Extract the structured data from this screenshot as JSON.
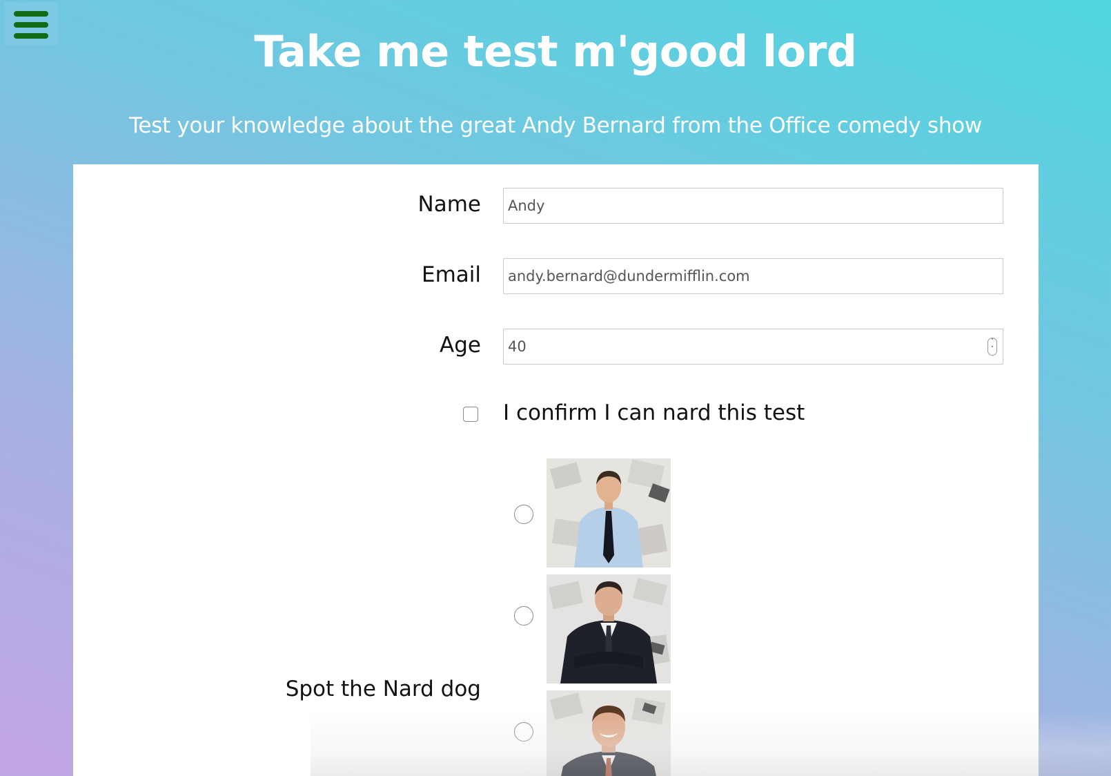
{
  "header": {
    "menu_icon": "hamburger-menu-icon",
    "menu_color": "#116a16",
    "title": "Take me test m'good lord",
    "subtitle": "Test your knowledge about the great Andy Bernard from the Office comedy show"
  },
  "form": {
    "name": {
      "label": "Name",
      "value": "Andy"
    },
    "email": {
      "label": "Email",
      "value": "andy.bernard@dundermifflin.com"
    },
    "age": {
      "label": "Age",
      "value": "40"
    },
    "confirm": {
      "label": "I confirm I can nard this test",
      "checked": false
    },
    "question": {
      "label": "Spot the Nard dog",
      "options": [
        {
          "image": "photo-man-blue-shirt-dark-tie",
          "selected": false
        },
        {
          "image": "photo-man-dark-suit-arms-crossed",
          "selected": false
        },
        {
          "image": "photo-man-smiling-suit",
          "selected": false
        }
      ]
    }
  },
  "colors": {
    "gradient_top_right": "#4fd6df",
    "gradient_bottom_left": "#c3a6e4",
    "card_background": "#ffffff"
  }
}
